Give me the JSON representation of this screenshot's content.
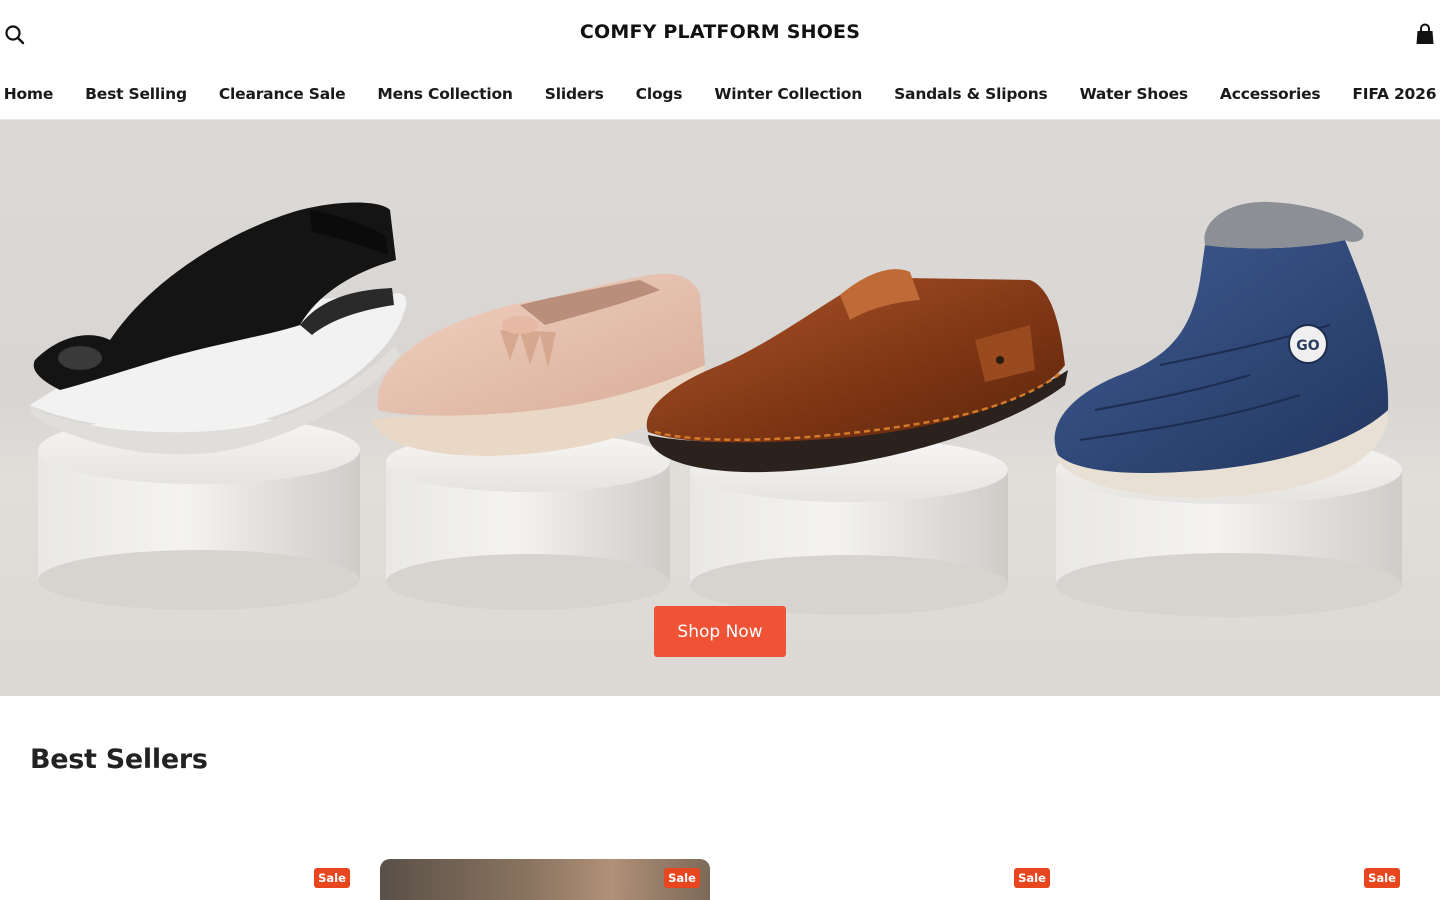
{
  "header": {
    "logo_text": "COMFY PLATFORM SHOES",
    "search_icon": "search-icon",
    "cart_icon": "shopping-bag-icon"
  },
  "nav": {
    "items": [
      {
        "label": "Home"
      },
      {
        "label": "Best Selling"
      },
      {
        "label": "Clearance Sale"
      },
      {
        "label": "Mens Collection"
      },
      {
        "label": "Sliders"
      },
      {
        "label": "Clogs"
      },
      {
        "label": "Winter Collection"
      },
      {
        "label": "Sandals & Slipons"
      },
      {
        "label": "Water Shoes"
      },
      {
        "label": "Accessories"
      },
      {
        "label": "FIFA 2026"
      }
    ]
  },
  "hero": {
    "cta_label": "Shop Now",
    "boot_logo": "GO"
  },
  "best_sellers": {
    "title": "Best Sellers",
    "products": [
      {
        "badge": "Sale"
      },
      {
        "badge": "Sale"
      },
      {
        "badge": "Sale"
      },
      {
        "badge": "Sale"
      }
    ]
  },
  "colors": {
    "accent": "#ef5235",
    "sale_badge": "#e8461f",
    "text": "#1a1a1a"
  }
}
